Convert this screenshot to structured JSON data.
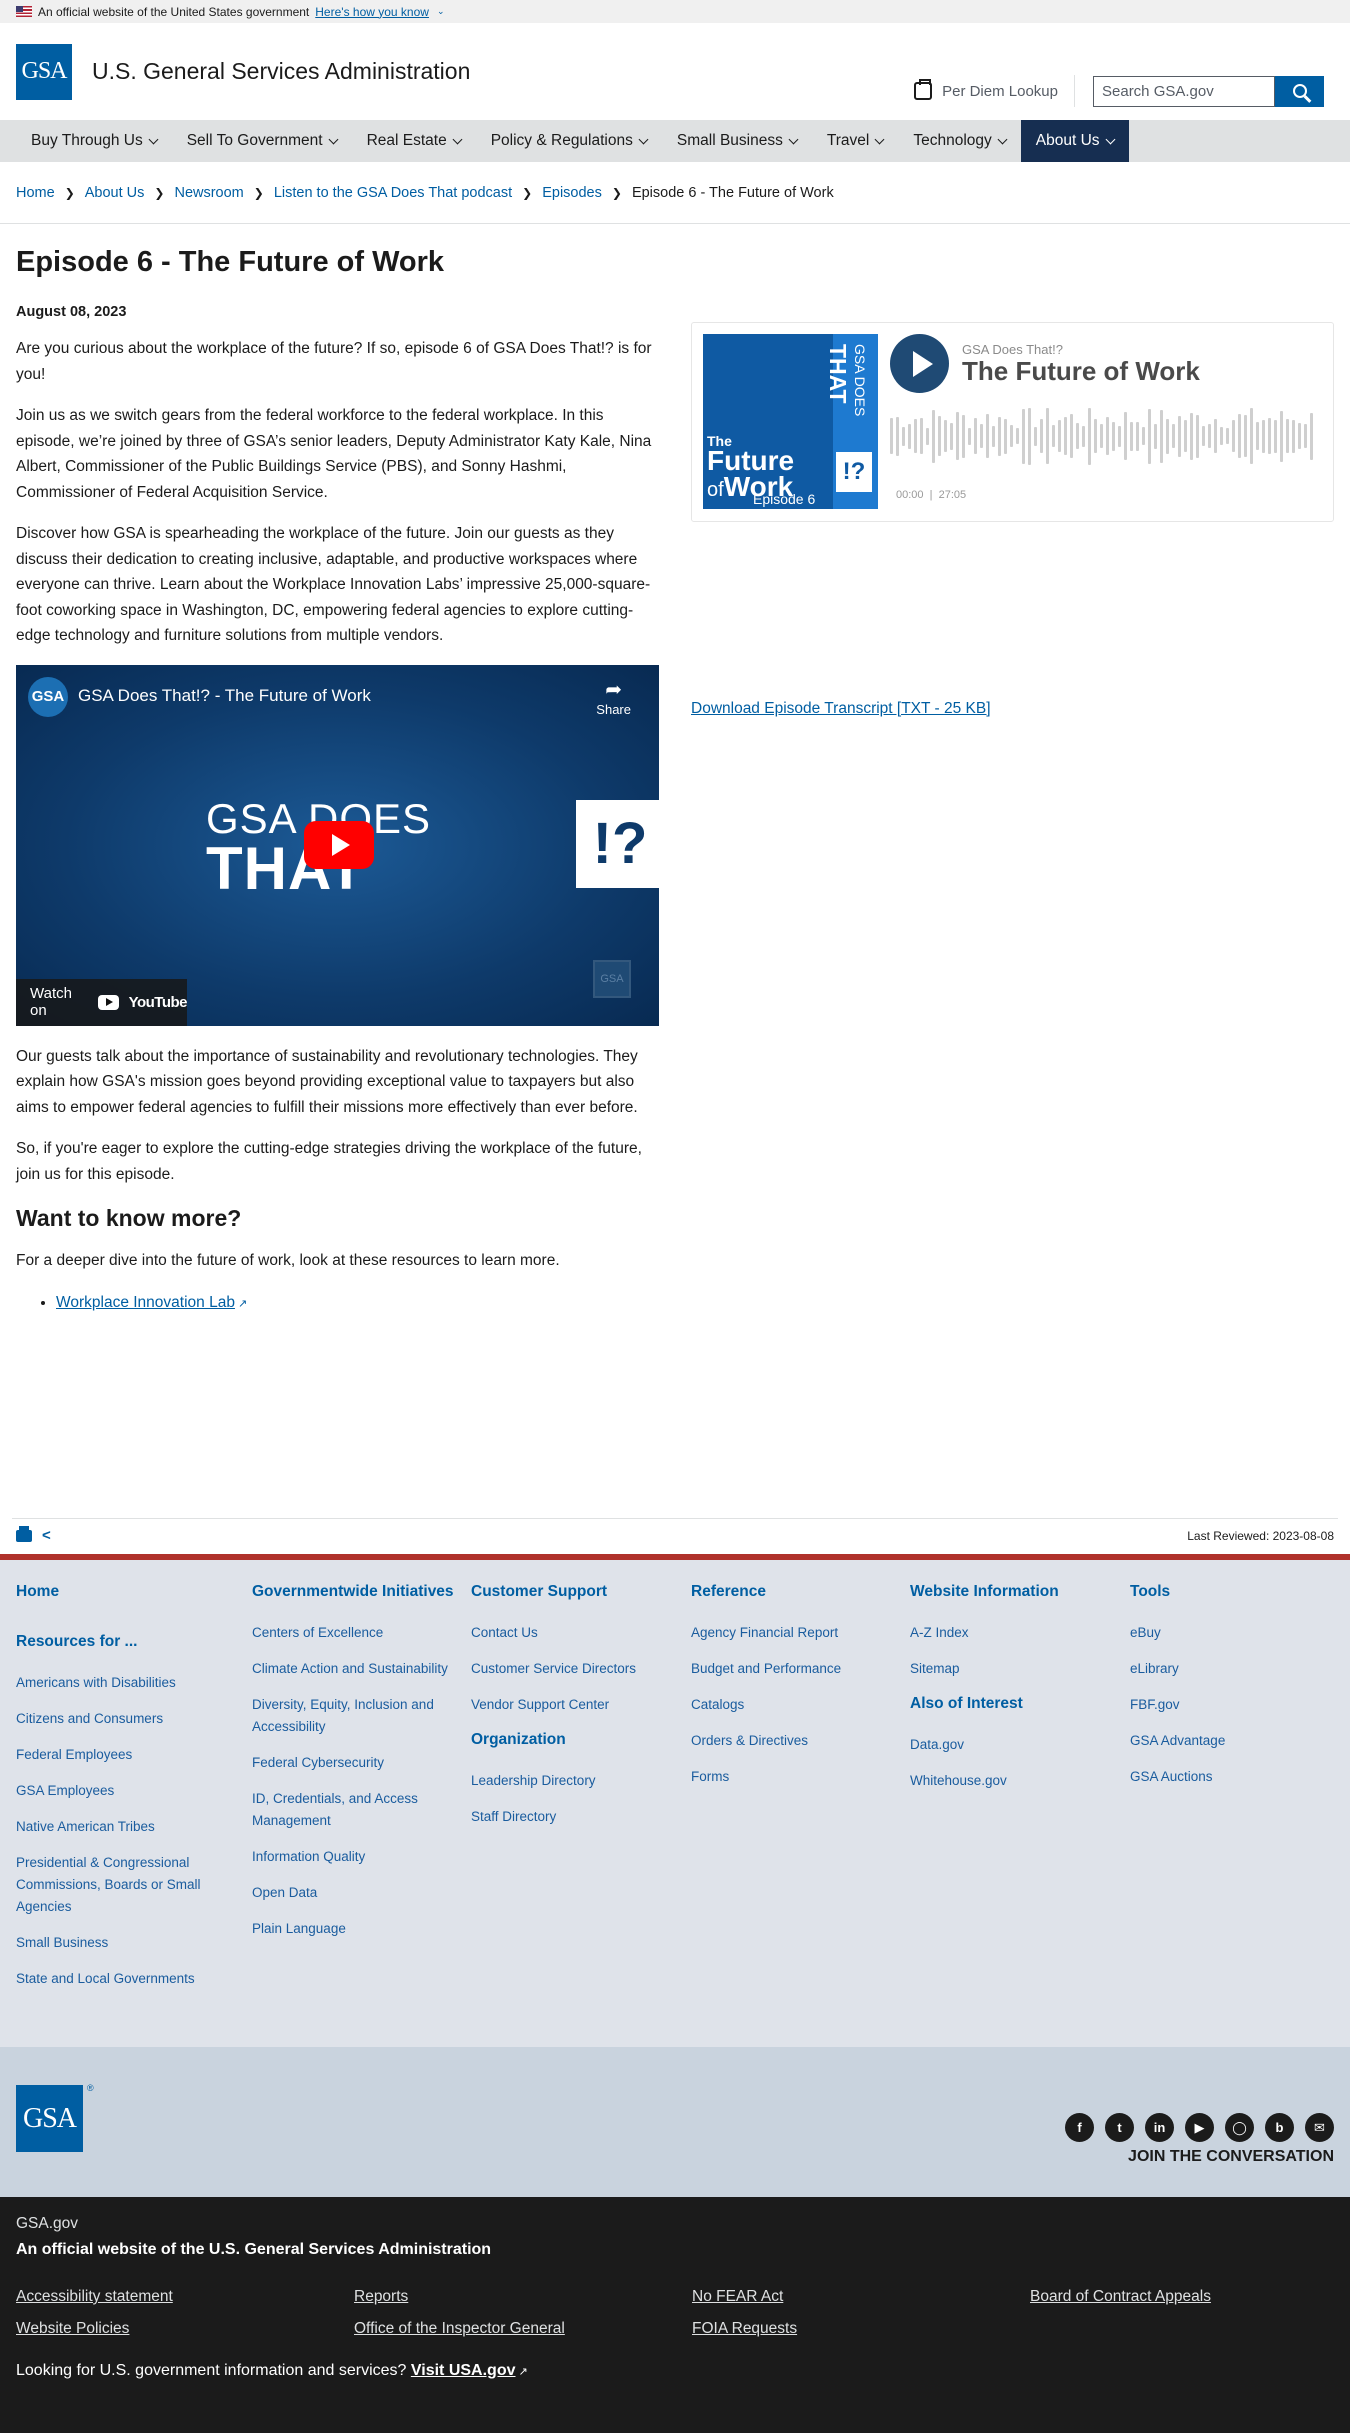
{
  "gov_banner": {
    "text": "An official website of the United States government",
    "link": "Here's how you know"
  },
  "header": {
    "logo": "GSA",
    "agency_name": "U.S. General Services Administration",
    "per_diem": "Per Diem Lookup",
    "search_placeholder": "Search GSA.gov",
    "search_icon": "search-icon"
  },
  "nav": {
    "items": [
      {
        "label": "Buy Through Us"
      },
      {
        "label": "Sell To Government"
      },
      {
        "label": "Real Estate"
      },
      {
        "label": "Policy & Regulations"
      },
      {
        "label": "Small Business"
      },
      {
        "label": "Travel"
      },
      {
        "label": "Technology"
      },
      {
        "label": "About Us"
      }
    ],
    "active_color": "#162e51"
  },
  "breadcrumb": {
    "items": [
      "Home",
      "About Us",
      "Newsroom",
      "Listen to the GSA Does That podcast",
      "Episodes"
    ],
    "current": "Episode 6 - The Future of Work"
  },
  "article": {
    "title": "Episode 6 - The Future of Work",
    "date": "August 08, 2023",
    "p1": "Are you curious about the workplace of the future? If so, episode 6 of GSA Does That!? is for you!",
    "p2": "Join us as we switch gears from the federal workforce to the federal workplace. In this episode, we’re joined by three of GSA’s senior leaders, Deputy Administrator Katy Kale, Nina Albert, Commissioner of the Public Buildings Service (PBS), and Sonny Hashmi, Commissioner of Federal Acquisition Service.",
    "p3": "Discover how GSA is spearheading the workplace of the future. Join our guests as they discuss their dedication to creating inclusive, adaptable, and productive workspaces where everyone can thrive. Learn about the Workplace Innovation Labs’ impressive 25,000-square-foot coworking space in Washington, DC, empowering federal agencies to explore cutting-edge technology and furniture solutions from multiple vendors.",
    "p4": "Our guests talk about the importance of sustainability and revolutionary technologies. They explain how GSA's mission goes beyond providing exceptional value to taxpayers but also aims to empower federal agencies to fulfill their missions more effectively than ever before.",
    "p5": "So, if you're eager to explore the cutting-edge strategies driving the workplace of the future, join us for this episode.",
    "h2": "Want to know more?",
    "p6": "For a deeper dive into the future of work, look at these resources to learn more.",
    "resource_link": "Workplace Innovation Lab"
  },
  "video": {
    "channel_logo": "GSA",
    "title": "GSA Does That!? - The Future of Work",
    "share": "Share",
    "big_line1": "GSA DOES",
    "big_line2": "THAT",
    "big_box": "!?",
    "watch_on": "Watch on",
    "youtube": "YouTube",
    "watermark": "GSA"
  },
  "player": {
    "show": "GSA Does That!?",
    "title": "The Future of Work",
    "current_time": "00:00",
    "duration": "27:05",
    "cover": {
      "top_small": "GSA DOES",
      "top_big": "THAT",
      "q": "!?",
      "future": "Future",
      "the": "The",
      "of": "of",
      "work": "Work",
      "episode": "Episode 6"
    }
  },
  "transcript_link": "Download Episode Transcript [TXT - 25 KB]",
  "meta": {
    "last_reviewed": "Last Reviewed: 2023-08-08"
  },
  "footer": {
    "col1": {
      "home": "Home",
      "resources": "Resources for ...",
      "links": [
        "Americans with Disabilities",
        "Citizens and Consumers",
        "Federal Employees",
        "GSA Employees",
        "Native American Tribes",
        "Presidential & Congressional Commissions, Boards or Small Agencies",
        "Small Business",
        "State and Local Governments"
      ]
    },
    "col2": {
      "head": "Governmentwide Initiatives",
      "links": [
        "Centers of Excellence",
        "Climate Action and Sustainability",
        "Diversity, Equity, Inclusion and Accessibility",
        "Federal Cybersecurity",
        "ID, Credentials, and Access Management",
        "Information Quality",
        "Open Data",
        "Plain Language"
      ]
    },
    "col3": {
      "head": "Customer Support",
      "links": [
        "Contact Us",
        "Customer Service Directors",
        "Vendor Support Center"
      ],
      "head2": "Organization",
      "links2": [
        "Leadership Directory",
        "Staff Directory"
      ]
    },
    "col4": {
      "head": "Reference",
      "links": [
        "Agency Financial Report",
        "Budget and Performance",
        "Catalogs",
        "Orders & Directives",
        "Forms"
      ]
    },
    "col5": {
      "head": "Website Information",
      "links": [
        "A-Z Index",
        "Sitemap"
      ],
      "head2": "Also of Interest",
      "links2": [
        "Data.gov",
        "Whitehouse.gov"
      ]
    },
    "col6": {
      "head": "Tools",
      "links": [
        "eBuy",
        "eLibrary",
        "FBF.gov",
        "GSA Advantage",
        "GSA Auctions"
      ]
    }
  },
  "logo_band": {
    "logo": "GSA",
    "reg": "®",
    "social_icons": [
      "facebook-icon",
      "twitter-icon",
      "linkedin-icon",
      "youtube-icon",
      "instagram-icon",
      "blog-icon",
      "email-icon"
    ],
    "join": "JOIN THE CONVERSATION"
  },
  "identifier": {
    "domain": "GSA.gov",
    "official": "An official website of the U.S. General Services Administration",
    "links": [
      "Accessibility statement",
      "Reports",
      "No FEAR Act",
      "Board of Contract Appeals",
      "Website Policies",
      "Office of the Inspector General",
      "FOIA Requests"
    ],
    "usa_text": "Looking for U.S. government information and services?",
    "usa_link": "Visit USA.gov"
  }
}
